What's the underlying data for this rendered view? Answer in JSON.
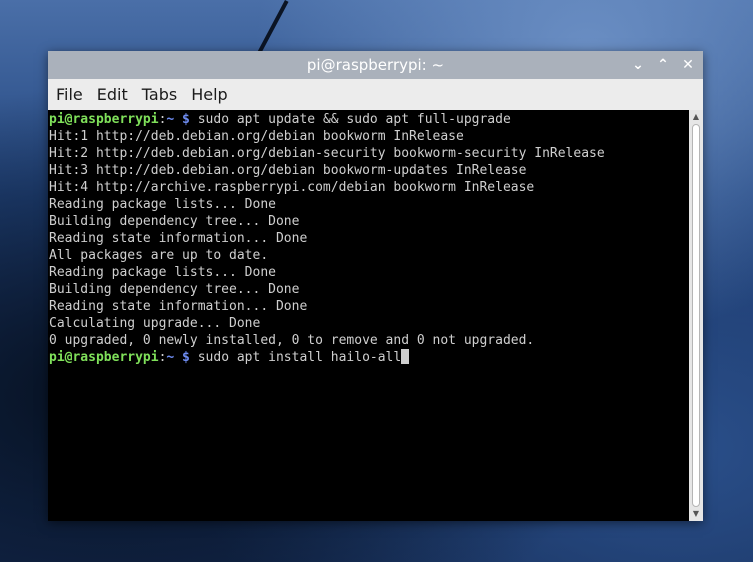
{
  "window": {
    "title": "pi@raspberrypi: ~",
    "controls": {
      "minimize": "⌄",
      "maximize": "⌃",
      "close": "✕"
    }
  },
  "menu": [
    "File",
    "Edit",
    "Tabs",
    "Help"
  ],
  "prompt": {
    "user": "pi@raspberrypi",
    "sep": ":",
    "path": "~",
    "dollar": " $"
  },
  "terminal": {
    "command_1": " sudo apt update && sudo apt full-upgrade",
    "output": [
      "Hit:1 http://deb.debian.org/debian bookworm InRelease",
      "Hit:2 http://deb.debian.org/debian-security bookworm-security InRelease",
      "Hit:3 http://deb.debian.org/debian bookworm-updates InRelease",
      "Hit:4 http://archive.raspberrypi.com/debian bookworm InRelease",
      "Reading package lists... Done",
      "Building dependency tree... Done",
      "Reading state information... Done",
      "All packages are up to date.",
      "Reading package lists... Done",
      "Building dependency tree... Done",
      "Reading state information... Done",
      "Calculating upgrade... Done",
      "0 upgraded, 0 newly installed, 0 to remove and 0 not upgraded."
    ],
    "command_2": " sudo apt install hailo-all"
  },
  "scrollbar": {
    "up": "▲",
    "down": "▼"
  },
  "colors": {
    "prompt_user": "#7fe05a",
    "prompt_path": "#6e8cf0",
    "terminal_bg": "#000000",
    "terminal_fg": "#cfcfcf",
    "titlebar": "#aab1bb"
  }
}
